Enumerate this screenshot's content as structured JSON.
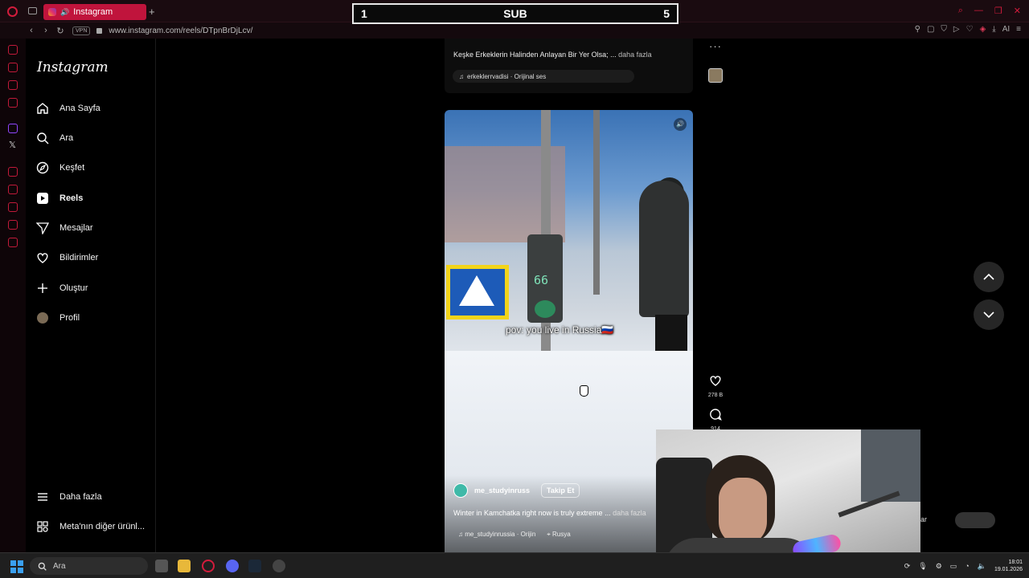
{
  "browser": {
    "tab_title": "Instagram",
    "tab_add": "+",
    "url": "www.instagram.com/reels/DTpnBrDjLcv/",
    "vpn_label": "VPN",
    "ai_label": "AI",
    "accent_color": "#c0143c"
  },
  "sub_counter": {
    "left": "1",
    "center": "SUB",
    "right": "5"
  },
  "instagram": {
    "logo": "Instagram",
    "nav": [
      {
        "label": "Ana Sayfa",
        "icon": "home-icon"
      },
      {
        "label": "Ara",
        "icon": "search-icon"
      },
      {
        "label": "Keşfet",
        "icon": "compass-icon"
      },
      {
        "label": "Reels",
        "icon": "reels-icon",
        "active": true
      },
      {
        "label": "Mesajlar",
        "icon": "messages-icon"
      },
      {
        "label": "Bildirimler",
        "icon": "heart-icon"
      },
      {
        "label": "Oluştur",
        "icon": "plus-icon"
      },
      {
        "label": "Profil",
        "icon": "avatar"
      }
    ],
    "bottom_nav": [
      {
        "label": "Daha fazla",
        "icon": "menu-icon"
      },
      {
        "label": "Meta'nın diğer ürünl...",
        "icon": "grid-icon"
      }
    ],
    "prev_reel": {
      "caption": "Keşke Erkeklerin Halinden Anlayan Bir Yer Olsa; ...",
      "more": "daha fazla",
      "audio": "erkeklerrvadisi · Orijinal ses"
    },
    "reel": {
      "overlay_text": "pov: you live in Russia🇷🇺",
      "author": "me_studyinruss",
      "follow_label": "Takip Et",
      "caption": "Winter in Kamchatka right now is truly extreme ...",
      "more": "daha fazla",
      "audio": "me_studyinrussia · Orijin",
      "location": "Rusya",
      "sign_number": "66",
      "likes": "278 B",
      "comments": "914"
    }
  },
  "webcam": {
    "label": "ar"
  },
  "taskbar": {
    "search_placeholder": "Ara",
    "time": "18:01",
    "date": "19.01.2026"
  }
}
